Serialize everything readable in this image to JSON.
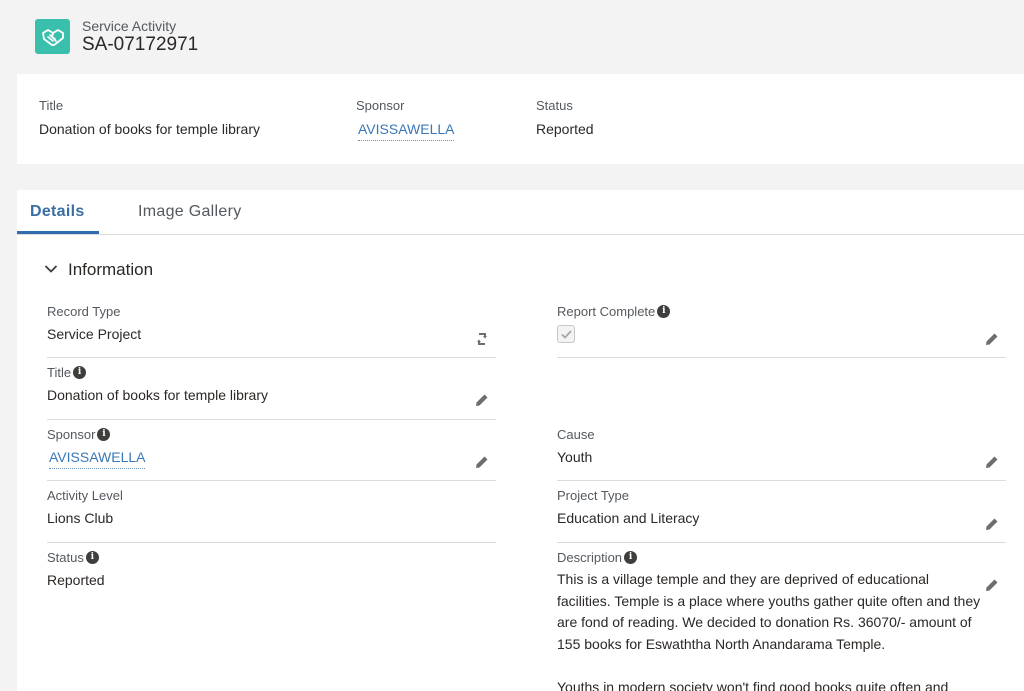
{
  "header": {
    "object_label": "Service Activity",
    "record_id": "SA-07172971",
    "icon": "handshake-icon",
    "icon_color": "#3bbfad"
  },
  "highlights": {
    "title_label": "Title",
    "title_value": "Donation of books for temple library",
    "sponsor_label": "Sponsor",
    "sponsor_value": "AVISSAWELLA",
    "status_label": "Status",
    "status_value": "Reported"
  },
  "tabs": [
    {
      "label": "Details",
      "active": true
    },
    {
      "label": "Image Gallery",
      "active": false
    }
  ],
  "section": {
    "title": "Information",
    "icon": "chevron-down-icon"
  },
  "fields": {
    "record_type": {
      "label": "Record Type",
      "value": "Service Project"
    },
    "title": {
      "label": "Title",
      "value": "Donation of books for temple library"
    },
    "sponsor": {
      "label": "Sponsor",
      "value": "AVISSAWELLA"
    },
    "activity_level": {
      "label": "Activity Level",
      "value": "Lions Club"
    },
    "status": {
      "label": "Status",
      "value": "Reported"
    },
    "report_complete": {
      "label": "Report Complete",
      "checked": true
    },
    "cause": {
      "label": "Cause",
      "value": "Youth"
    },
    "project_type": {
      "label": "Project Type",
      "value": "Education and Literacy"
    },
    "description": {
      "label": "Description",
      "paragraph1": "This is a village temple and they are deprived of educational facilities. Temple is a place where youths gather quite often and they are fond of reading. We decided to donation Rs. 36070/- amount of 155 books for Eswaththa North Anandarama Temple.",
      "paragraph2": "Youths in modern society won't find good books quite often and"
    }
  },
  "info_icon_glyph": "i",
  "colors": {
    "link": "#3a78b7",
    "active_tab": "#2f6dae",
    "background": "#f3f3f3"
  }
}
